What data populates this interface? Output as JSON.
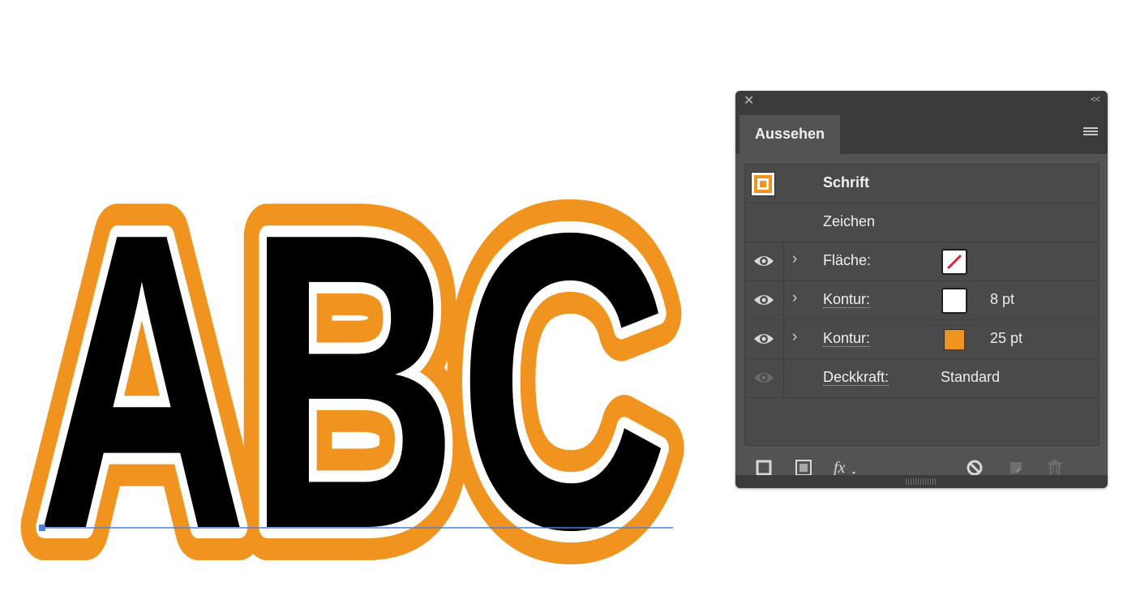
{
  "artwork": {
    "text": "ABC",
    "colors": {
      "fill": "#000000",
      "inner_stroke": "#ffffff",
      "outer_stroke": "#f0931f",
      "baseline": "#4a7fe0"
    }
  },
  "panel": {
    "tab_title": "Aussehen",
    "rows": {
      "object": {
        "label": "Schrift"
      },
      "characters": {
        "label": "Zeichen"
      },
      "fill": {
        "label": "Fläche:"
      },
      "stroke1": {
        "label": "Kontur:",
        "value": "8 pt",
        "color": "#ffffff"
      },
      "stroke2": {
        "label": "Kontur:",
        "value": "25 pt",
        "color": "#f0931f"
      },
      "opacity": {
        "label": "Deckkraft:",
        "value": "Standard"
      }
    },
    "icons": {
      "close": "close-icon",
      "collapse": "collapse-icon",
      "menu": "panel-menu-icon",
      "new_stroke": "add-stroke-icon",
      "new_fill": "add-fill-icon",
      "fx": "fx-icon",
      "clear": "clear-appearance-icon",
      "duplicate": "duplicate-item-icon",
      "delete": "delete-icon"
    }
  }
}
